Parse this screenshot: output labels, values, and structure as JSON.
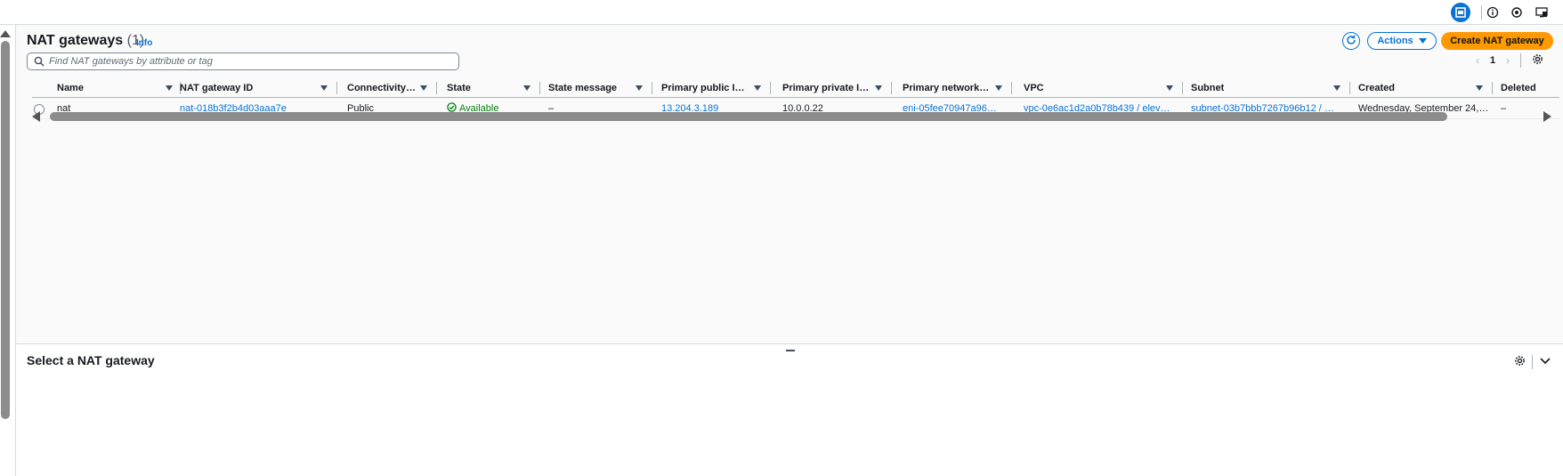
{
  "list": {
    "title": "NAT gateways",
    "count": "(1)",
    "info": "Info",
    "search_placeholder": "Find NAT gateways by attribute or tag",
    "actions_label": "Actions",
    "create_label": "Create NAT gateway",
    "page": "1",
    "columns": [
      "Name",
      "NAT gateway ID",
      "Connectivity…",
      "State",
      "State message",
      "Primary public I…",
      "Primary private I…",
      "Primary network…",
      "VPC",
      "Subnet",
      "Created",
      "Deleted"
    ],
    "row": {
      "name": "nat",
      "id": "nat-018b3f2b4d03aaa7e",
      "connectivity": "Public",
      "state": "Available",
      "state_message": "–",
      "public_ip": "13.204.3.189",
      "private_ip": "10.0.0.22",
      "network_interface": "eni-05fee70947a96…",
      "vpc": "vpc-0e6ac1d2a0b78b439 / elev…",
      "subnet": "subnet-03b7bbb7267b96b12 / …",
      "created": "Wednesday, September 24,…",
      "deleted": "–"
    }
  },
  "split_panel": {
    "title": "Select a NAT gateway"
  },
  "colors": {
    "link": "#0972d3",
    "primary_button": "#ff9900",
    "success": "#037f0c"
  },
  "icons": [
    "panel-toggle-icon",
    "info-icon",
    "notifications-icon",
    "display-icon",
    "search-icon",
    "refresh-icon",
    "caret-down-icon",
    "chevron-left-icon",
    "chevron-right-icon",
    "settings-gear-icon",
    "status-success-icon",
    "chevron-down-icon"
  ]
}
